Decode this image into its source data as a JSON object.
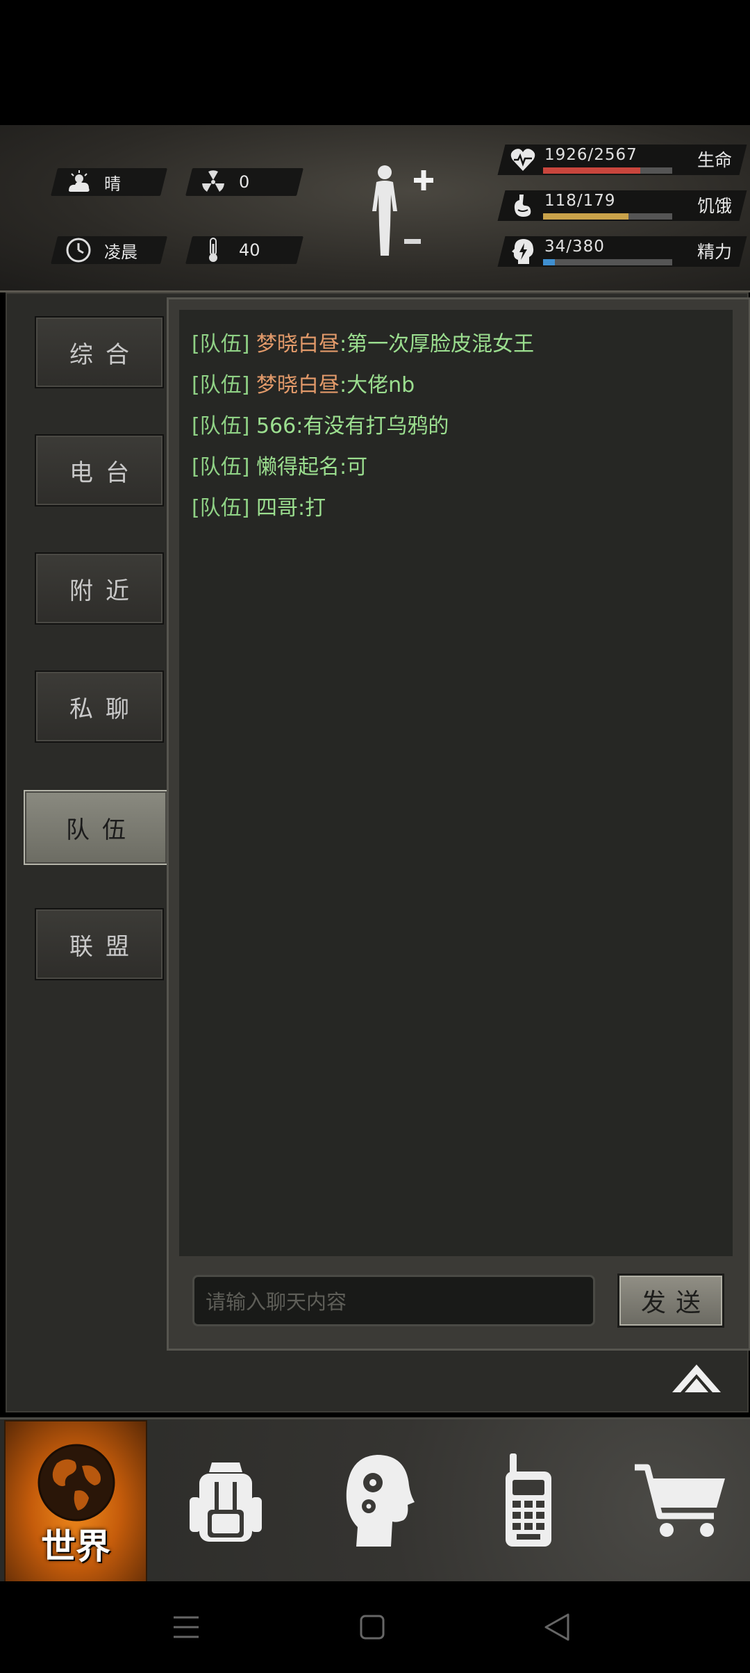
{
  "status": {
    "weather": "晴",
    "radiation": "0",
    "time_of_day": "凌晨",
    "temperature": "40"
  },
  "vitals": [
    {
      "label": "生命",
      "value": "1926/2567",
      "fraction": 0.75,
      "color": "#c9463d",
      "icon": "heart-icon"
    },
    {
      "label": "饥饿",
      "value": "118/179",
      "fraction": 0.66,
      "color": "#c9a24a",
      "icon": "stomach-icon"
    },
    {
      "label": "精力",
      "value": "34/380",
      "fraction": 0.09,
      "color": "#3f8fd0",
      "icon": "energy-icon"
    }
  ],
  "tabs": [
    {
      "label": "综合",
      "active": false
    },
    {
      "label": "电台",
      "active": false
    },
    {
      "label": "附近",
      "active": false
    },
    {
      "label": "私聊",
      "active": false
    },
    {
      "label": "队伍",
      "active": true
    },
    {
      "label": "联盟",
      "active": false
    }
  ],
  "chat": [
    {
      "tag": "[队伍]",
      "name": "梦晓白昼",
      "message": ":第一次厚脸皮混女王"
    },
    {
      "tag": "[队伍]",
      "name": "梦晓白昼",
      "message": ":大佬nb"
    },
    {
      "tag": "[队伍]",
      "name": "",
      "message": "566:有没有打乌鸦的"
    },
    {
      "tag": "[队伍]",
      "name": "",
      "message": "懒得起名:可"
    },
    {
      "tag": "[队伍]",
      "name": "",
      "message": "四哥:打"
    }
  ],
  "input": {
    "placeholder": "请输入聊天内容"
  },
  "send_label": "发送",
  "nav": {
    "world_label": "世界"
  }
}
